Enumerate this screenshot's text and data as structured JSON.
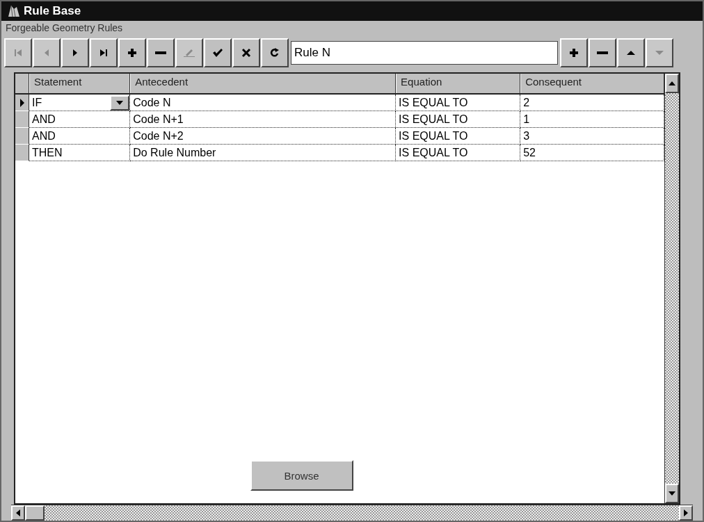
{
  "window": {
    "title": "Rule Base"
  },
  "group": {
    "label": "Forgeable Geometry Rules"
  },
  "toolbar": {
    "nav_buttons": [
      {
        "kind": "first",
        "disabled": true
      },
      {
        "kind": "prior",
        "disabled": true
      },
      {
        "kind": "next",
        "disabled": false
      },
      {
        "kind": "last",
        "disabled": false
      },
      {
        "kind": "insert",
        "disabled": false
      },
      {
        "kind": "delete",
        "disabled": false
      },
      {
        "kind": "edit",
        "disabled": true
      },
      {
        "kind": "post",
        "disabled": false
      },
      {
        "kind": "cancel",
        "disabled": false
      },
      {
        "kind": "refresh",
        "disabled": false
      }
    ],
    "rule_field": {
      "value": "Rule N"
    },
    "rule_buttons": [
      {
        "kind": "insert",
        "disabled": false
      },
      {
        "kind": "delete",
        "disabled": false
      },
      {
        "kind": "up",
        "disabled": false
      },
      {
        "kind": "down",
        "disabled": true
      }
    ]
  },
  "table": {
    "columns": [
      "Statement",
      "Antecedent",
      "Equation",
      "Consequent"
    ],
    "rows": [
      {
        "selected": true,
        "cells": [
          "IF",
          "Code N",
          "IS EQUAL TO",
          "2"
        ]
      },
      {
        "selected": false,
        "cells": [
          "AND",
          "Code N+1",
          "IS EQUAL TO",
          "1"
        ]
      },
      {
        "selected": false,
        "cells": [
          "AND",
          "Code N+2",
          "IS EQUAL TO",
          "3"
        ]
      },
      {
        "selected": false,
        "cells": [
          "THEN",
          "Do Rule Number",
          "IS EQUAL TO",
          "52"
        ]
      }
    ]
  },
  "buttons": [
    {
      "label": "Browse"
    }
  ]
}
